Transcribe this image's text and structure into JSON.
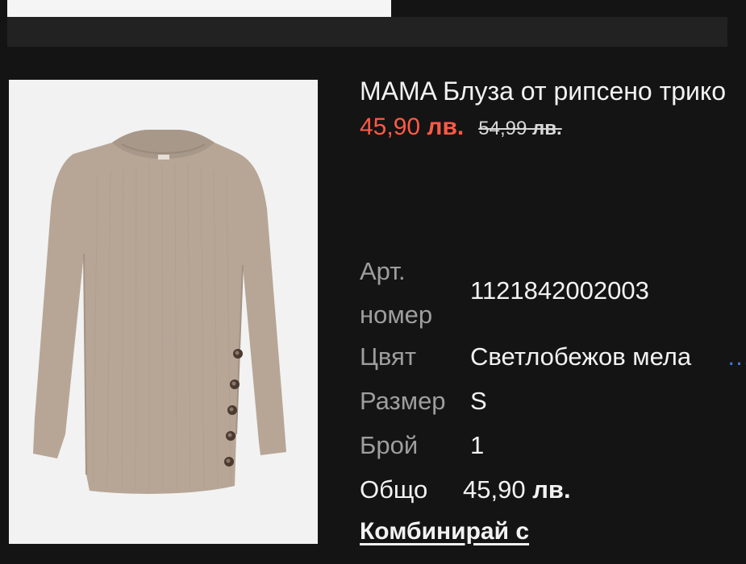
{
  "product": {
    "title": "MAMA Блуза от рипсено трико",
    "price_current_amount": "45,90",
    "price_current_currency": "лв.",
    "price_old_amount": "54,99",
    "price_old_currency": "лв.",
    "image_alt": "garment-photo"
  },
  "details": {
    "article_label": "Арт. номер",
    "article_value": "1121842002003",
    "color_label": "Цвят",
    "color_value": "Светлобежов мела",
    "color_overflow": "…",
    "size_label": "Размер",
    "size_value": "S",
    "qty_label": "Брой",
    "qty_value": "1",
    "total_label": "Общо",
    "total_amount": "45,90",
    "total_currency": "лв."
  },
  "actions": {
    "combine_label": "Комбинирай с"
  },
  "colors": {
    "background": "#141414",
    "sale_price": "#ff5a45",
    "muted_label": "#9e9e9e",
    "garment": "#b7a696"
  }
}
